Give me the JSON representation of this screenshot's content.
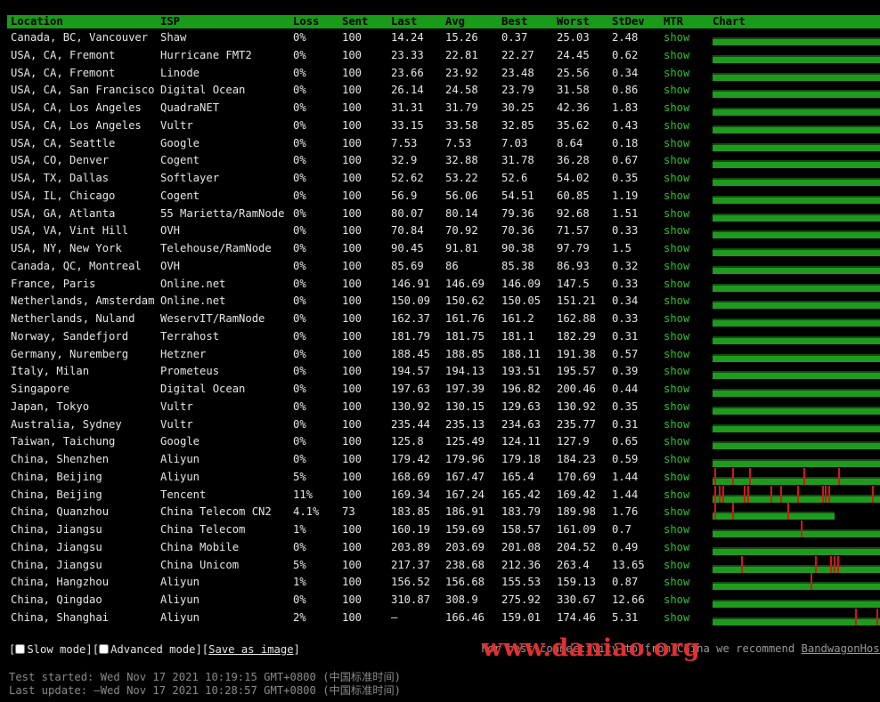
{
  "headers": [
    "Location",
    "ISP",
    "Loss",
    "Sent",
    "Last",
    "Avg",
    "Best",
    "Worst",
    "StDev",
    "MTR",
    "Chart"
  ],
  "rows": [
    {
      "location": "Canada, BC, Vancouver",
      "isp": "Shaw",
      "loss": "0%",
      "sent": "100",
      "last": "14.24",
      "avg": "15.26",
      "best": "0.37",
      "worst": "25.03",
      "stdev": "2.48",
      "mtr": "show",
      "loss_marks": []
    },
    {
      "location": "USA, CA, Fremont",
      "isp": "Hurricane FMT2",
      "loss": "0%",
      "sent": "100",
      "last": "23.33",
      "avg": "22.81",
      "best": "22.27",
      "worst": "24.45",
      "stdev": "0.62",
      "mtr": "show",
      "loss_marks": []
    },
    {
      "location": "USA, CA, Fremont",
      "isp": "Linode",
      "loss": "0%",
      "sent": "100",
      "last": "23.66",
      "avg": "23.92",
      "best": "23.48",
      "worst": "25.56",
      "stdev": "0.34",
      "mtr": "show",
      "loss_marks": []
    },
    {
      "location": "USA, CA, San Francisco",
      "isp": "Digital Ocean",
      "loss": "0%",
      "sent": "100",
      "last": "26.14",
      "avg": "24.58",
      "best": "23.79",
      "worst": "31.58",
      "stdev": "0.86",
      "mtr": "show",
      "loss_marks": []
    },
    {
      "location": "USA, CA, Los Angeles",
      "isp": "QuadraNET",
      "loss": "0%",
      "sent": "100",
      "last": "31.31",
      "avg": "31.79",
      "best": "30.25",
      "worst": "42.36",
      "stdev": "1.83",
      "mtr": "show",
      "loss_marks": []
    },
    {
      "location": "USA, CA, Los Angeles",
      "isp": "Vultr",
      "loss": "0%",
      "sent": "100",
      "last": "33.15",
      "avg": "33.58",
      "best": "32.85",
      "worst": "35.62",
      "stdev": "0.43",
      "mtr": "show",
      "loss_marks": []
    },
    {
      "location": "USA, CA, Seattle",
      "isp": "Google",
      "loss": "0%",
      "sent": "100",
      "last": "7.53",
      "avg": "7.53",
      "best": "7.03",
      "worst": "8.64",
      "stdev": "0.18",
      "mtr": "show",
      "loss_marks": []
    },
    {
      "location": "USA, CO, Denver",
      "isp": "Cogent",
      "loss": "0%",
      "sent": "100",
      "last": "32.9",
      "avg": "32.88",
      "best": "31.78",
      "worst": "36.28",
      "stdev": "0.67",
      "mtr": "show",
      "loss_marks": []
    },
    {
      "location": "USA, TX, Dallas",
      "isp": "Softlayer",
      "loss": "0%",
      "sent": "100",
      "last": "52.62",
      "avg": "53.22",
      "best": "52.6",
      "worst": "54.02",
      "stdev": "0.35",
      "mtr": "show",
      "loss_marks": []
    },
    {
      "location": "USA, IL, Chicago",
      "isp": "Cogent",
      "loss": "0%",
      "sent": "100",
      "last": "56.9",
      "avg": "56.06",
      "best": "54.51",
      "worst": "60.85",
      "stdev": "1.19",
      "mtr": "show",
      "loss_marks": []
    },
    {
      "location": "USA, GA, Atlanta",
      "isp": "55 Marietta/RamNode",
      "loss": "0%",
      "sent": "100",
      "last": "80.07",
      "avg": "80.14",
      "best": "79.36",
      "worst": "92.68",
      "stdev": "1.51",
      "mtr": "show",
      "loss_marks": []
    },
    {
      "location": "USA, VA, Vint Hill",
      "isp": "OVH",
      "loss": "0%",
      "sent": "100",
      "last": "70.84",
      "avg": "70.92",
      "best": "70.36",
      "worst": "71.57",
      "stdev": "0.33",
      "mtr": "show",
      "loss_marks": []
    },
    {
      "location": "USA, NY, New York",
      "isp": "Telehouse/RamNode",
      "loss": "0%",
      "sent": "100",
      "last": "90.45",
      "avg": "91.81",
      "best": "90.38",
      "worst": "97.79",
      "stdev": "1.5",
      "mtr": "show",
      "loss_marks": []
    },
    {
      "location": "Canada, QC, Montreal",
      "isp": "OVH",
      "loss": "0%",
      "sent": "100",
      "last": "85.69",
      "avg": "86",
      "best": "85.38",
      "worst": "86.93",
      "stdev": "0.32",
      "mtr": "show",
      "loss_marks": []
    },
    {
      "location": "France, Paris",
      "isp": "Online.net",
      "loss": "0%",
      "sent": "100",
      "last": "146.91",
      "avg": "146.69",
      "best": "146.09",
      "worst": "147.5",
      "stdev": "0.33",
      "mtr": "show",
      "loss_marks": []
    },
    {
      "location": "Netherlands, Amsterdam",
      "isp": "Online.net",
      "loss": "0%",
      "sent": "100",
      "last": "150.09",
      "avg": "150.62",
      "best": "150.05",
      "worst": "151.21",
      "stdev": "0.34",
      "mtr": "show",
      "loss_marks": []
    },
    {
      "location": "Netherlands, Nuland",
      "isp": "WeservIT/RamNode",
      "loss": "0%",
      "sent": "100",
      "last": "162.37",
      "avg": "161.76",
      "best": "161.2",
      "worst": "162.88",
      "stdev": "0.33",
      "mtr": "show",
      "loss_marks": []
    },
    {
      "location": "Norway, Sandefjord",
      "isp": "Terrahost",
      "loss": "0%",
      "sent": "100",
      "last": "181.79",
      "avg": "181.75",
      "best": "181.1",
      "worst": "182.29",
      "stdev": "0.31",
      "mtr": "show",
      "loss_marks": []
    },
    {
      "location": "Germany, Nuremberg",
      "isp": "Hetzner",
      "loss": "0%",
      "sent": "100",
      "last": "188.45",
      "avg": "188.85",
      "best": "188.11",
      "worst": "191.38",
      "stdev": "0.57",
      "mtr": "show",
      "loss_marks": []
    },
    {
      "location": "Italy, Milan",
      "isp": "Prometeus",
      "loss": "0%",
      "sent": "100",
      "last": "194.57",
      "avg": "194.13",
      "best": "193.51",
      "worst": "195.57",
      "stdev": "0.39",
      "mtr": "show",
      "loss_marks": []
    },
    {
      "location": "Singapore",
      "isp": "Digital Ocean",
      "loss": "0%",
      "sent": "100",
      "last": "197.63",
      "avg": "197.39",
      "best": "196.82",
      "worst": "200.46",
      "stdev": "0.44",
      "mtr": "show",
      "loss_marks": []
    },
    {
      "location": "Japan, Tokyo",
      "isp": "Vultr",
      "loss": "0%",
      "sent": "100",
      "last": "130.92",
      "avg": "130.15",
      "best": "129.63",
      "worst": "130.92",
      "stdev": "0.35",
      "mtr": "show",
      "loss_marks": []
    },
    {
      "location": "Australia, Sydney",
      "isp": "Vultr",
      "loss": "0%",
      "sent": "100",
      "last": "235.44",
      "avg": "235.13",
      "best": "234.63",
      "worst": "235.77",
      "stdev": "0.31",
      "mtr": "show",
      "loss_marks": []
    },
    {
      "location": "Taiwan, Taichung",
      "isp": "Google",
      "loss": "0%",
      "sent": "100",
      "last": "125.8",
      "avg": "125.49",
      "best": "124.11",
      "worst": "127.9",
      "stdev": "0.65",
      "mtr": "show",
      "loss_marks": []
    },
    {
      "location": "China, Shenzhen",
      "isp": "Aliyun",
      "loss": "0%",
      "sent": "100",
      "last": "179.42",
      "avg": "179.96",
      "best": "179.18",
      "worst": "184.23",
      "stdev": "0.59",
      "mtr": "show",
      "loss_marks": []
    },
    {
      "location": "China, Beijing",
      "isp": "Aliyun",
      "loss": "5%",
      "sent": "100",
      "last": "168.69",
      "avg": "167.47",
      "best": "165.4",
      "worst": "170.69",
      "stdev": "1.44",
      "mtr": "show",
      "loss_marks": [
        0.01,
        0.12,
        0.22,
        0.55,
        0.76
      ]
    },
    {
      "location": "China, Beijing",
      "isp": "Tencent",
      "loss": "11%",
      "sent": "100",
      "last": "169.34",
      "avg": "167.24",
      "best": "165.42",
      "worst": "169.42",
      "stdev": "1.44",
      "mtr": "show",
      "loss_marks": [
        0.01,
        0.04,
        0.06,
        0.19,
        0.21,
        0.35,
        0.41,
        0.51,
        0.66,
        0.68,
        0.7,
        0.96
      ]
    },
    {
      "location": "China, Quanzhou",
      "isp": "China Telecom CN2",
      "loss": "4.1%",
      "sent": "73",
      "last": "183.85",
      "avg": "186.91",
      "best": "183.79",
      "worst": "189.98",
      "stdev": "1.76",
      "mtr": "show",
      "loss_marks": [
        0.01,
        0.12,
        0.45
      ]
    },
    {
      "location": "China, Jiangsu",
      "isp": "China Telecom",
      "loss": "1%",
      "sent": "100",
      "last": "160.19",
      "avg": "159.69",
      "best": "158.57",
      "worst": "161.09",
      "stdev": "0.7",
      "mtr": "show",
      "loss_marks": [
        0.53
      ]
    },
    {
      "location": "China, Jiangsu",
      "isp": "China Mobile",
      "loss": "0%",
      "sent": "100",
      "last": "203.89",
      "avg": "203.69",
      "best": "201.08",
      "worst": "204.52",
      "stdev": "0.49",
      "mtr": "show",
      "loss_marks": []
    },
    {
      "location": "China, Jiangsu",
      "isp": "China Unicom",
      "loss": "5%",
      "sent": "100",
      "last": "217.37",
      "avg": "238.68",
      "best": "212.36",
      "worst": "263.4",
      "stdev": "13.65",
      "mtr": "show",
      "loss_marks": [
        0.17,
        0.62,
        0.71,
        0.73,
        0.75
      ]
    },
    {
      "location": "China, Hangzhou",
      "isp": "Aliyun",
      "loss": "1%",
      "sent": "100",
      "last": "156.52",
      "avg": "156.68",
      "best": "155.53",
      "worst": "159.13",
      "stdev": "0.87",
      "mtr": "show",
      "loss_marks": [
        0.59
      ]
    },
    {
      "location": "China, Qingdao",
      "isp": "Aliyun",
      "loss": "0%",
      "sent": "100",
      "last": "310.87",
      "avg": "308.9",
      "best": "275.92",
      "worst": "330.67",
      "stdev": "12.66",
      "mtr": "show",
      "loss_marks": []
    },
    {
      "location": "China, Shanghai",
      "isp": "Aliyun",
      "loss": "2%",
      "sent": "100",
      "last": "–",
      "avg": "166.46",
      "best": "159.01",
      "worst": "174.46",
      "stdev": "5.31",
      "mtr": "show",
      "loss_marks": [
        0.86,
        0.99
      ]
    }
  ],
  "footer": {
    "bracket_open": "[",
    "slow_mode": "Slow mode",
    "sep1": "][",
    "advanced_mode": "Advanced mode",
    "sep2": "][",
    "save_image": "Save as image",
    "bracket_close": "]",
    "recommend_text": "For best connectivity to/from China we recommend ",
    "recommend_link": "BandwagonHost",
    "test_started": "Test started: Wed Nov 17 2021 10:19:15 GMT+0800 (中国标准时间)",
    "last_update": "Last update: —Wed Nov 17 2021 10:28:57 GMT+0800 (中国标准时间)"
  },
  "watermark": "www.daniao.org",
  "colors": {
    "header_bg": "#199a19",
    "chart_green": "#1f9a1f",
    "loss_red": "#d01818",
    "mtr_link": "#2fbf2f"
  }
}
